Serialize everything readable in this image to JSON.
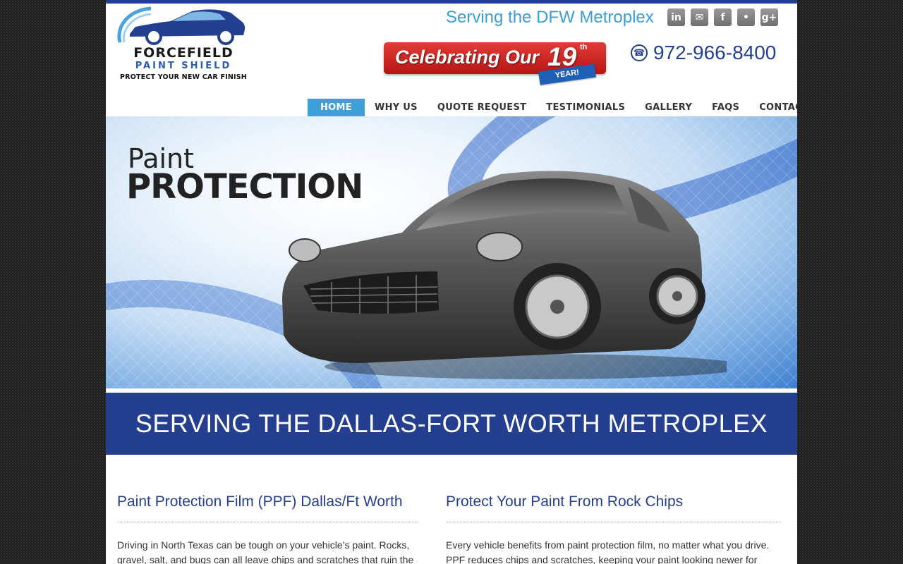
{
  "logo": {
    "line1": "FORCEFIELD",
    "line2": "PAINT SHIELD",
    "line3": "PROTECT YOUR NEW CAR FINISH"
  },
  "header": {
    "serving": "Serving the DFW Metroplex",
    "celebrate_prefix": "Celebrating Our",
    "celebrate_number": "19",
    "celebrate_suffix": "th",
    "celebrate_ribbon": "YEAR!",
    "phone": "972-966-8400"
  },
  "socials": [
    {
      "name": "linkedin-icon",
      "glyph": "in"
    },
    {
      "name": "chat-icon",
      "glyph": "✉"
    },
    {
      "name": "facebook-icon",
      "glyph": "f"
    },
    {
      "name": "twitter-icon",
      "glyph": "•"
    },
    {
      "name": "google-plus-icon",
      "glyph": "g+"
    }
  ],
  "nav": [
    "HOME",
    "WHY US",
    "QUOTE REQUEST",
    "TESTIMONIALS",
    "GALLERY",
    "FAQS",
    "CONTACT US"
  ],
  "hero": {
    "line1": "Paint",
    "line2": "PROTECTION"
  },
  "band": "SERVING THE DALLAS-FORT WORTH METROPLEX",
  "content": {
    "col1": {
      "title": "Paint Protection Film (PPF) Dallas/Ft Worth",
      "text": "Driving in North Texas can be tough on your vehicle’s paint. Rocks, gravel, salt, and bugs can all leave chips and scratches that ruin the"
    },
    "col2": {
      "title": "Protect Your Paint From Rock Chips",
      "text": "Every vehicle benefits from paint protection film, no matter what you drive. PPF reduces chips and scratches, keeping your paint looking newer for"
    }
  },
  "colors": {
    "brand_blue": "#243f8f",
    "accent_blue": "#3ea0d8",
    "celebrate_red": "#d22b27"
  }
}
